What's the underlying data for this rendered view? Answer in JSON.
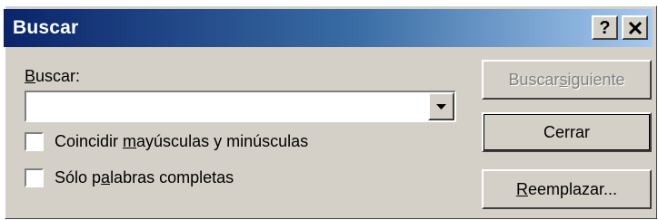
{
  "window": {
    "title": "Buscar",
    "help_label": "?"
  },
  "find": {
    "label": {
      "before": "",
      "mnemonic": "B",
      "after": "uscar:"
    },
    "value": "",
    "placeholder": ""
  },
  "options": [
    {
      "label": {
        "before": "Coincidir ",
        "mnemonic": "m",
        "after": "ayúsculas y minúsculas"
      },
      "checked": false
    },
    {
      "label": {
        "before": "Sólo p",
        "mnemonic": "a",
        "after": "labras completas"
      },
      "checked": false
    }
  ],
  "buttons": {
    "find_next": {
      "before": "Buscar ",
      "mnemonic": "s",
      "after": "iguiente",
      "enabled": false
    },
    "close": {
      "before": "Cerrar",
      "mnemonic": "",
      "after": ""
    },
    "replace": {
      "before": "",
      "mnemonic": "R",
      "after": "eemplazar..."
    }
  },
  "colors": {
    "title_gradient_start": "#0a246a",
    "title_gradient_end": "#a6caf0",
    "face": "#d4d0c8",
    "disabled_text": "#808080"
  },
  "icons": {
    "dropdown": "chevron-down-icon",
    "close": "close-icon"
  }
}
